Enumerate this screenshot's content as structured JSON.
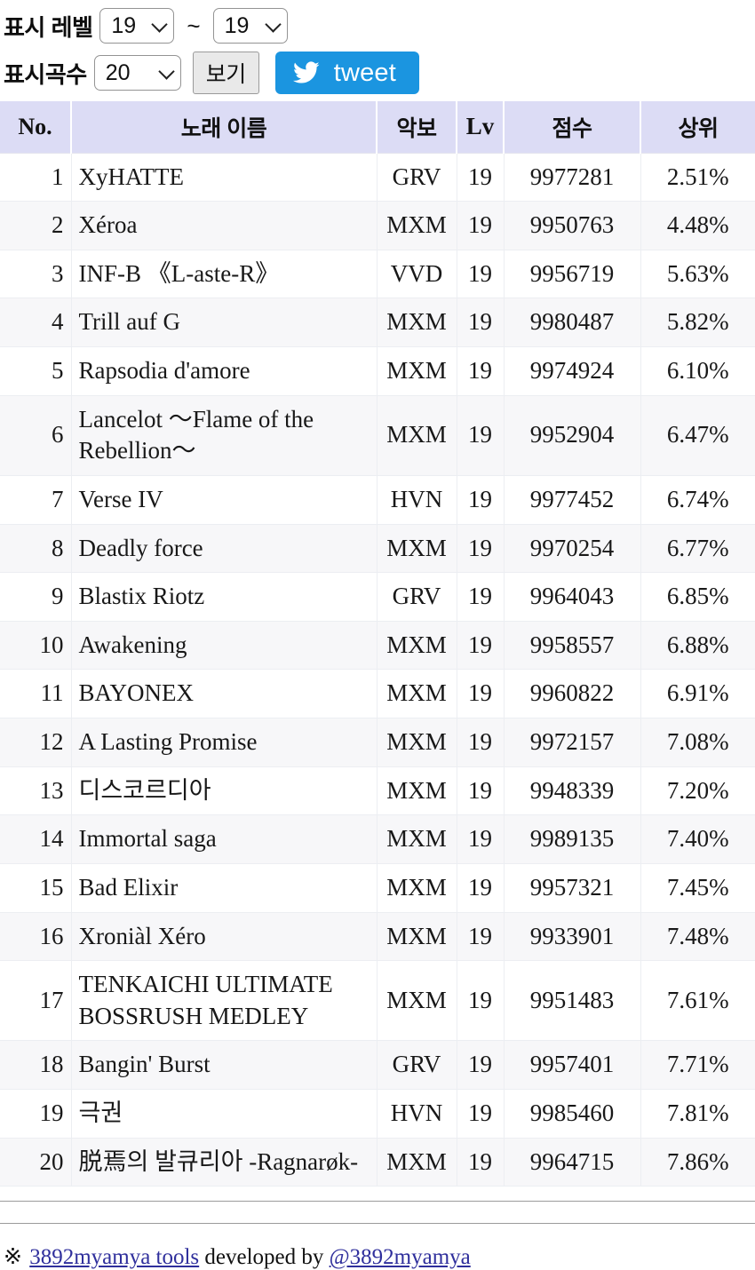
{
  "controls": {
    "level_label": "표시 레벨",
    "level_from": "19",
    "level_to": "19",
    "range_separator": "~",
    "count_label": "표시곡수",
    "count_value": "20",
    "view_button": "보기",
    "tweet_button": "tweet",
    "icons": {
      "chevron": "chevron-down-icon",
      "twitter": "twitter-bird-icon"
    }
  },
  "table": {
    "headers": {
      "no": "No.",
      "name": "노래 이름",
      "akbo": "악보",
      "lv": "Lv",
      "score": "점수",
      "rate": "상위"
    },
    "rows": [
      {
        "no": "1",
        "name": "XyHATTE",
        "akbo": "GRV",
        "lv": "19",
        "score": "9977281",
        "rate": "2.51%"
      },
      {
        "no": "2",
        "name": "Xéroa",
        "akbo": "MXM",
        "lv": "19",
        "score": "9950763",
        "rate": "4.48%"
      },
      {
        "no": "3",
        "name": "INF-B 《L-aste-R》",
        "akbo": "VVD",
        "lv": "19",
        "score": "9956719",
        "rate": "5.63%"
      },
      {
        "no": "4",
        "name": "Trill auf G",
        "akbo": "MXM",
        "lv": "19",
        "score": "9980487",
        "rate": "5.82%"
      },
      {
        "no": "5",
        "name": "Rapsodia d'amore",
        "akbo": "MXM",
        "lv": "19",
        "score": "9974924",
        "rate": "6.10%"
      },
      {
        "no": "6",
        "name": "Lancelot 〜Flame of the Rebellion〜",
        "akbo": "MXM",
        "lv": "19",
        "score": "9952904",
        "rate": "6.47%"
      },
      {
        "no": "7",
        "name": "Verse IV",
        "akbo": "HVN",
        "lv": "19",
        "score": "9977452",
        "rate": "6.74%"
      },
      {
        "no": "8",
        "name": "Deadly force",
        "akbo": "MXM",
        "lv": "19",
        "score": "9970254",
        "rate": "6.77%"
      },
      {
        "no": "9",
        "name": "Blastix Riotz",
        "akbo": "GRV",
        "lv": "19",
        "score": "9964043",
        "rate": "6.85%"
      },
      {
        "no": "10",
        "name": "Awakening",
        "akbo": "MXM",
        "lv": "19",
        "score": "9958557",
        "rate": "6.88%"
      },
      {
        "no": "11",
        "name": "BAYONEX",
        "akbo": "MXM",
        "lv": "19",
        "score": "9960822",
        "rate": "6.91%"
      },
      {
        "no": "12",
        "name": "A Lasting Promise",
        "akbo": "MXM",
        "lv": "19",
        "score": "9972157",
        "rate": "7.08%"
      },
      {
        "no": "13",
        "name": "디스코르디아",
        "akbo": "MXM",
        "lv": "19",
        "score": "9948339",
        "rate": "7.20%"
      },
      {
        "no": "14",
        "name": "Immortal saga",
        "akbo": "MXM",
        "lv": "19",
        "score": "9989135",
        "rate": "7.40%"
      },
      {
        "no": "15",
        "name": "Bad Elixir",
        "akbo": "MXM",
        "lv": "19",
        "score": "9957321",
        "rate": "7.45%"
      },
      {
        "no": "16",
        "name": "Xroniàl Xéro",
        "akbo": "MXM",
        "lv": "19",
        "score": "9933901",
        "rate": "7.48%"
      },
      {
        "no": "17",
        "name": "TENKAICHI ULTIMATE BOSSRUSH MEDLEY",
        "akbo": "MXM",
        "lv": "19",
        "score": "9951483",
        "rate": "7.61%"
      },
      {
        "no": "18",
        "name": "Bangin' Burst",
        "akbo": "GRV",
        "lv": "19",
        "score": "9957401",
        "rate": "7.71%"
      },
      {
        "no": "19",
        "name": "극권",
        "akbo": "HVN",
        "lv": "19",
        "score": "9985460",
        "rate": "7.81%"
      },
      {
        "no": "20",
        "name": "脱焉의 발큐리아 -Ragnarøk-",
        "akbo": "MXM",
        "lv": "19",
        "score": "9964715",
        "rate": "7.86%"
      }
    ]
  },
  "footer": {
    "star": "※",
    "tools_link": "3892myamya tools",
    "middle_text": " developed by ",
    "author_link": "@3892myamya"
  },
  "colors": {
    "header_bg": "#dcdcf5",
    "tweet_blue": "#1b95e0",
    "grv": "#d9a52e",
    "vvd": "#e3418e",
    "hvn": "#3fbde2",
    "mxm": "#2a2a2a",
    "link": "#2f2f9c"
  }
}
